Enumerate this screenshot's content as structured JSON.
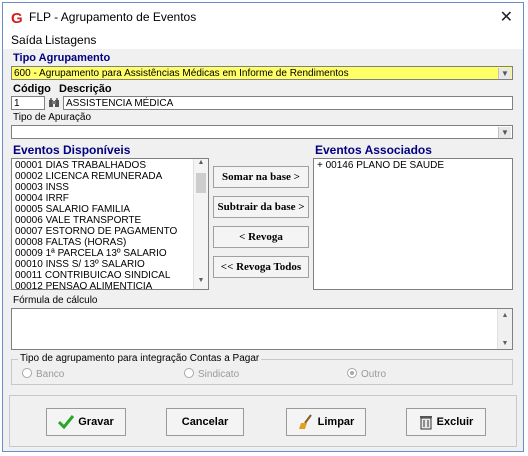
{
  "window": {
    "title": "FLP - Agrupamento de Eventos",
    "close_glyph": "✕",
    "logo_letter": "G"
  },
  "menu": {
    "items": [
      {
        "label": "Saída"
      },
      {
        "label": "Listagens"
      }
    ]
  },
  "tipo_agrupamento": {
    "label": "Tipo Agrupamento",
    "value": "600 - Agrupamento para Assistências Médicas em Informe de Rendimentos"
  },
  "codigo": {
    "label": "Código",
    "value": "1"
  },
  "descricao": {
    "label": "Descrição",
    "value": "ASSISTENCIA MÉDICA"
  },
  "tipo_apuracao": {
    "label": "Tipo de Apuração",
    "value": ""
  },
  "eventos_disponiveis": {
    "label": "Eventos Disponíveis",
    "items": [
      "00001 DIAS TRABALHADOS",
      "00002 LICENCA REMUNERADA",
      "00003 INSS",
      "00004 IRRF",
      "00005 SALARIO FAMILIA",
      "00006 VALE TRANSPORTE",
      "00007 ESTORNO DE PAGAMENTO",
      "00008 FALTAS (HORAS)",
      "00009 1ª PARCELA 13º SALARIO",
      "00010 INSS S/ 13º SALARIO",
      "00011 CONTRIBUICAO SINDICAL",
      "00012 PENSAO ALIMENTICIA"
    ]
  },
  "eventos_associados": {
    "label": "Eventos Associados",
    "items": [
      "+ 00146 PLANO DE SAUDE"
    ]
  },
  "transfer_buttons": {
    "somar": "Somar na base >",
    "subtrair": "Subtrair da base >",
    "revoga": "< Revoga",
    "revoga_todos": "<< Revoga Todos"
  },
  "formula": {
    "label": "Fórmula de cálculo",
    "value": ""
  },
  "integracao": {
    "label": "Tipo de agrupamento para integração Contas a Pagar",
    "options": [
      {
        "label": "Banco"
      },
      {
        "label": "Sindicato"
      },
      {
        "label": "Outro",
        "checked": true
      }
    ]
  },
  "actions": {
    "gravar": "Gravar",
    "cancelar": "Cancelar",
    "limpar": "Limpar",
    "excluir": "Excluir"
  },
  "colors": {
    "title_blue": "#000080",
    "highlight_yellow": "#ffff66",
    "logo_red": "#d42020",
    "check_green": "#2aa52a"
  },
  "icons": {
    "close": "close-icon",
    "lookup": "binoculars-icon",
    "gravar": "checkmark-icon",
    "limpar": "broom-icon",
    "excluir": "trash-icon"
  }
}
